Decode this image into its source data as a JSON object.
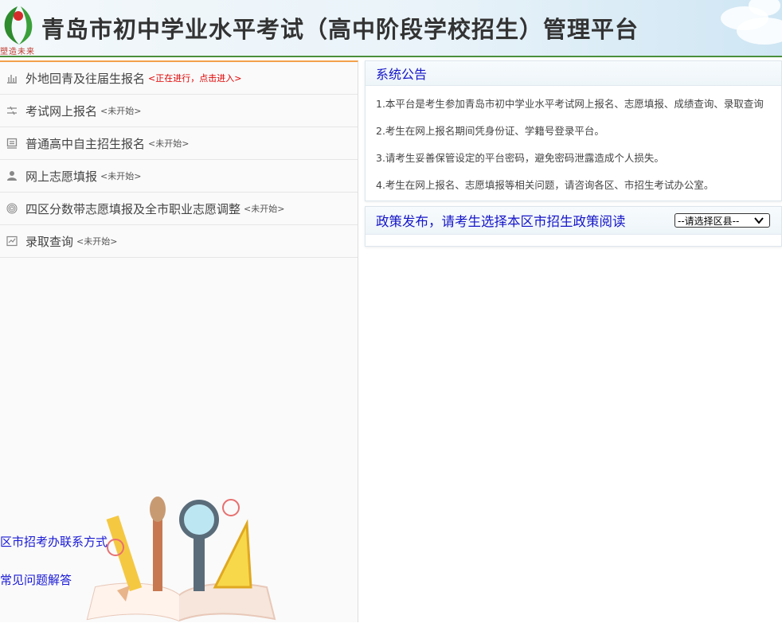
{
  "header": {
    "title": "青岛市初中学业水平考试（高中阶段学校招生）管理平台",
    "logo_text": "塑造未来"
  },
  "sidebar": {
    "items": [
      {
        "label": "外地回青及往届生报名",
        "status": "<正在进行，点击进入>",
        "active": true,
        "icon": "bar-chart-icon"
      },
      {
        "label": "考试网上报名",
        "status": "<未开始>",
        "active": false,
        "icon": "sliders-icon"
      },
      {
        "label": "普通高中自主招生报名",
        "status": "<未开始>",
        "active": false,
        "icon": "list-window-icon"
      },
      {
        "label": "网上志愿填报",
        "status": "<未开始>",
        "active": false,
        "icon": "user-icon"
      },
      {
        "label": "四区分数带志愿填报及全市职业志愿调整",
        "status": "<未开始>",
        "active": false,
        "icon": "fingerprint-icon"
      },
      {
        "label": "录取查询",
        "status": "<未开始>",
        "active": false,
        "icon": "line-chart-icon"
      }
    ],
    "links": {
      "contact": "区市招考办联系方式",
      "faq": "常见问题解答"
    }
  },
  "main": {
    "announcement": {
      "title": "系统公告",
      "items": [
        "1.本平台是考生参加青岛市初中学业水平考试网上报名、志愿填报、成绩查询、录取查询",
        "2.考生在网上报名期间凭身份证、学籍号登录平台。",
        "3.请考生妥善保管设定的平台密码，避免密码泄露造成个人损失。",
        "4.考生在网上报名、志愿填报等相关问题，请咨询各区、市招生考试办公室。"
      ]
    },
    "policy": {
      "title": "政策发布，请考生选择本区市招生政策阅读",
      "select_value": "--请选择区县--"
    }
  },
  "colors": {
    "link": "#1a1ad6",
    "active_status": "#e00000",
    "accent_line": "#f3a04a",
    "header_line": "#4a8f3a"
  }
}
